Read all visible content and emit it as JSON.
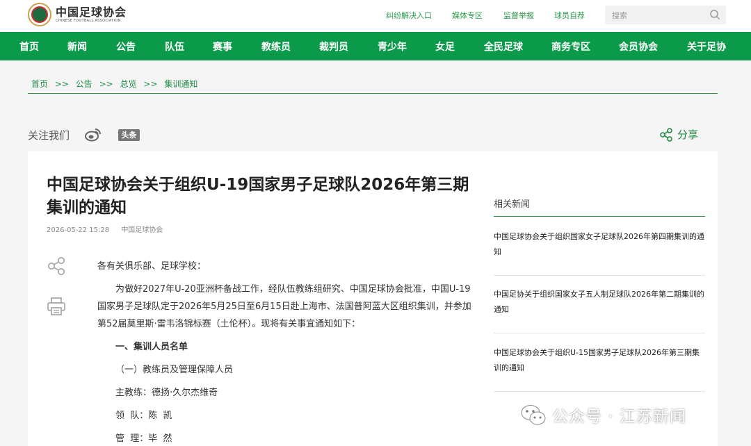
{
  "header": {
    "logo_cn": "中国足球协会",
    "logo_en": "CHINESE FOOTBALL ASSOCIATION",
    "links": [
      "纠纷解决入口",
      "媒体专区",
      "监督举报",
      "球员自荐"
    ],
    "search_placeholder": "搜索"
  },
  "nav": [
    "首页",
    "新闻",
    "公告",
    "队伍",
    "赛事",
    "教练员",
    "裁判员",
    "青少年",
    "女足",
    "全民足球",
    "商务专区",
    "会员协会",
    "关于足协"
  ],
  "breadcrumb": [
    "首页",
    ">>",
    "公告",
    ">>",
    "总览",
    ">>",
    "集训通知"
  ],
  "follow": {
    "label": "关注我们",
    "toutiao": "头条",
    "share": "分享"
  },
  "article": {
    "title": "中国足球协会关于组织U-19国家男子足球队2026年第三期集训的通知",
    "date": "2026-05-22 15:28",
    "source": "中国足球协会",
    "paragraphs": [
      "各有关俱乐部、足球学校：",
      "为做好2027年U-20亚洲杯备战工作，经队伍教练组研究、中国足球协会批准，中国U-19国家男子足球队定于2026年5月25日至6月15日赴上海市、法国普阿蓝大区组织集训，并参加第52届莫里斯·雷韦洛锦标赛（土伦杯）。现将有关事宜通知如下：",
      "一、集训人员名单",
      "（一）教练员及管理保障人员",
      "主教练：德扬·久尔杰维奇",
      "领  队：陈  凯",
      "管  理：毕  然"
    ]
  },
  "related": {
    "title": "相关新闻",
    "items": [
      "中国足球协会关于组织国家女子足球队2026年第四期集训的通知",
      "中国足协关于组织国家女子五人制足球队2026年第二期集训的通知",
      "中国足球协会关于组织U-15国家男子足球队2026年第三期集训的通知"
    ]
  },
  "watermark": "公众号 · 江苏新闻",
  "colors": {
    "brand_green": "#0a9a4a",
    "link_green": "#2a9a4a"
  }
}
